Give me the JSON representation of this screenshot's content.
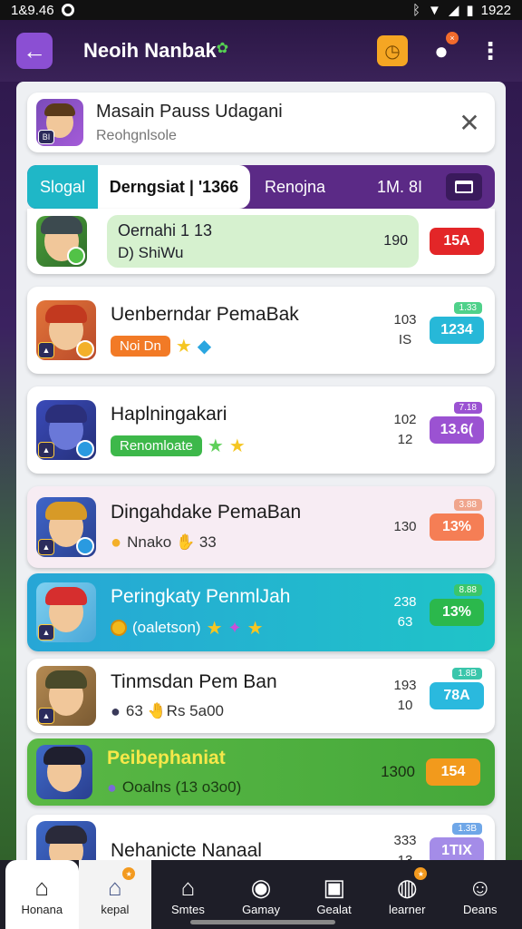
{
  "status": {
    "time_left": "1&9.46",
    "time_right": "1922"
  },
  "header": {
    "title": "Neoih Nanbak"
  },
  "profile": {
    "name": "Masain Pauss Udagani",
    "sub": "Reohgnlsole",
    "badge": "BI"
  },
  "tabs": {
    "tab1": "Slogal",
    "tab2": "Derngsiat | '1366",
    "tab3": "Renojna",
    "tab3_value": "1M. 8I"
  },
  "rows": [
    {
      "title": "Oernahi 1 13",
      "sub": "D) ShiWu",
      "num": "190",
      "score": "15A",
      "score_color": "#e32628"
    },
    {
      "title": "Uenberndar PemaBak",
      "tag": "Noi Dn",
      "num_top": "103",
      "num_bottom": "IS",
      "small_tag": "1.33",
      "score": "1234",
      "score_color": "#27b8d8",
      "tag_color": "#4fd18a"
    },
    {
      "title": "Haplningakari",
      "tag": "Renomloate",
      "num_top": "102",
      "num_bottom": "12",
      "small_tag": "7.18",
      "score": "13.6(",
      "score_color": "#9b52d2",
      "tag_color": "#9b52d2"
    },
    {
      "title": "Dingahdake PemaBan",
      "sub": "Nnako ✋ 33",
      "num": "130",
      "small_tag": "3.88",
      "score": "13%",
      "score_color": "#f57e55",
      "tag_color": "#f0a58c"
    },
    {
      "title": "Peringkaty PenmlJah",
      "tag": "(oaletson)",
      "num_top": "238",
      "num_bottom": "63",
      "small_tag": "8.88",
      "score": "13%",
      "score_color": "#2bb84c",
      "tag_color": "#3bc66a"
    },
    {
      "title": "Tinmsdan Pem Ban",
      "sub": "63 🤚Rs 5a00",
      "num_top": "193",
      "num_bottom": "10",
      "small_tag": "1.8B",
      "score": "78A",
      "score_color": "#2ab9de",
      "tag_color": "#3ac6ab"
    },
    {
      "title": "Peibephaniat",
      "sub": "Ooalns (13 o3o0)",
      "num": "1300",
      "score": "154",
      "score_color": "#f29a1c"
    },
    {
      "title": "Nehanicte Nanaal",
      "num_top": "333",
      "num_bottom": "13",
      "small_tag": "1.3B",
      "score": "1TIX",
      "score_color": "#a48ce8",
      "tag_color": "#6fa7e8"
    }
  ],
  "nav": [
    {
      "label": "Honana",
      "icon": "home-icon"
    },
    {
      "label": "kepal",
      "icon": "house-icon"
    },
    {
      "label": "Smtes",
      "icon": "store-icon"
    },
    {
      "label": "Gamay",
      "icon": "games-icon"
    },
    {
      "label": "Gealat",
      "icon": "gift-icon"
    },
    {
      "label": "learner",
      "icon": "controller-icon"
    },
    {
      "label": "Deans",
      "icon": "profile-icon"
    }
  ]
}
